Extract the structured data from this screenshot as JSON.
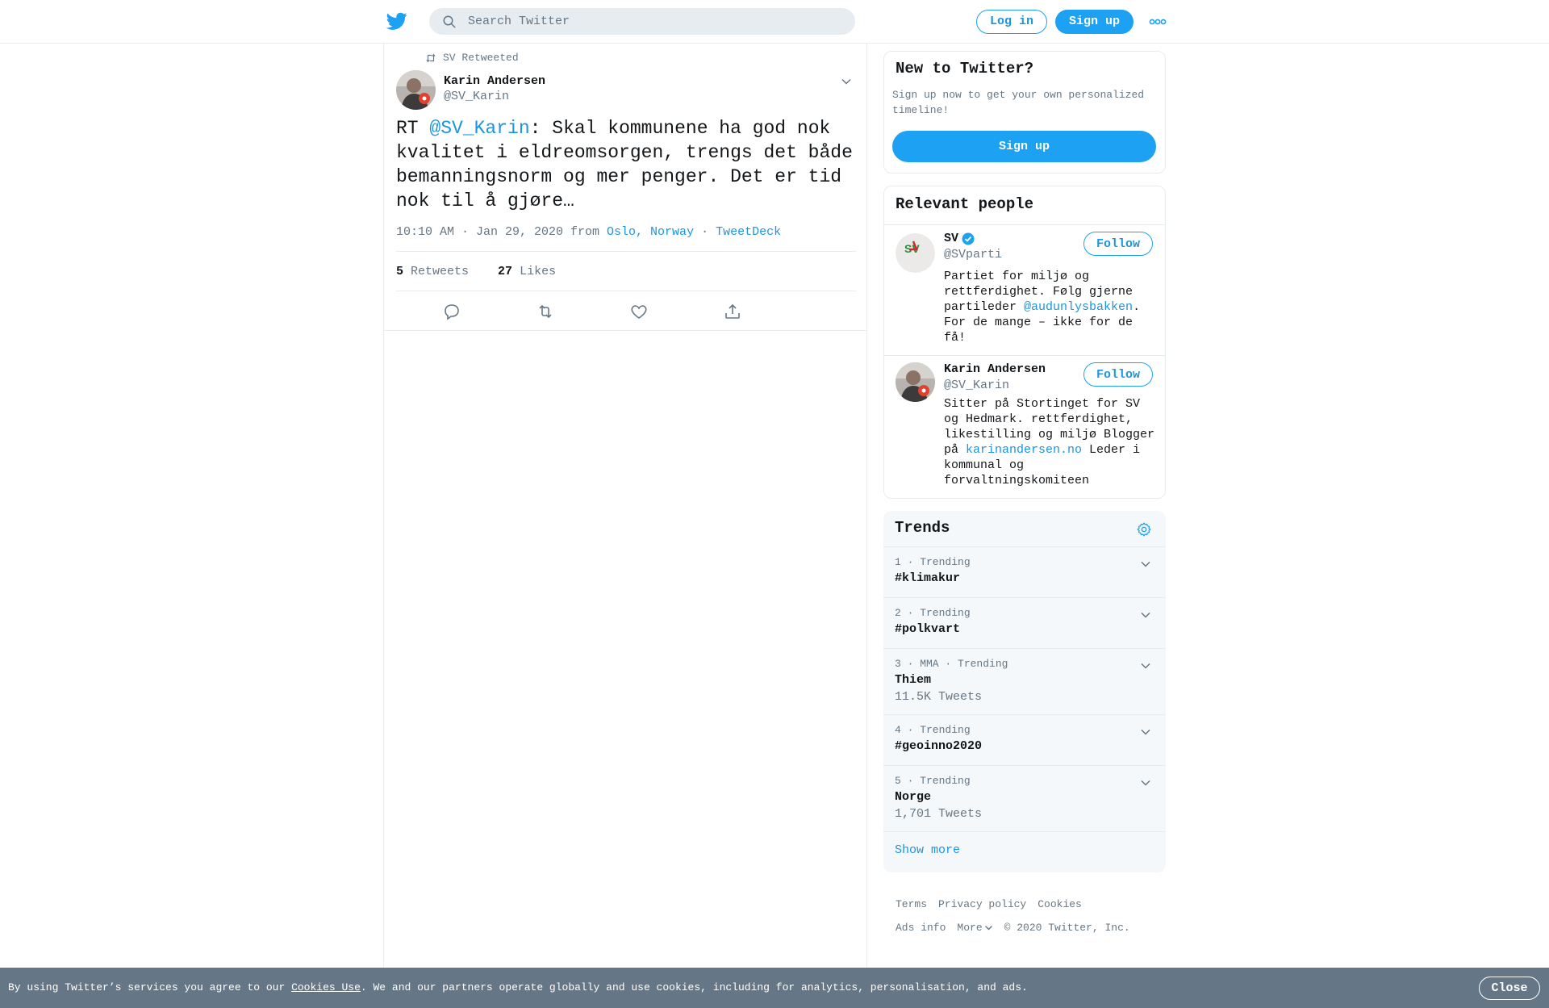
{
  "colors": {
    "brand": "#1da1f2",
    "link": "#1b95e0",
    "muted": "#657786",
    "border": "#e6ecf0",
    "cookie_bg": "#657786"
  },
  "header": {
    "search_placeholder": "Search Twitter",
    "login_label": "Log in",
    "signup_label": "Sign up"
  },
  "tweet": {
    "retweeted_by": "SV Retweeted",
    "author_name": "Karin Andersen",
    "author_handle": "@SV_Karin",
    "text_prefix": "RT ",
    "text_mention": "@SV_Karin",
    "text_body": ": Skal kommunene ha god nok kvalitet i eldreomsorgen, trengs det både bemanningsnorm og mer penger. Det er tid nok til å gjøre…",
    "timestamp": "10:10 AM · Jan 29, 2020 from ",
    "location": "Oslo, Norway",
    "separator": " · ",
    "source": "TweetDeck",
    "retweets_count": "5",
    "retweets_label": " Retweets",
    "likes_count": "27",
    "likes_label": " Likes"
  },
  "new_to_twitter": {
    "title": "New to Twitter?",
    "description": "Sign up now to get your own personalized timeline!",
    "button": "Sign up"
  },
  "relevant_people": {
    "title": "Relevant people",
    "follow_label": "Follow",
    "people": [
      {
        "name": "SV",
        "handle": "@SVparti",
        "bio_1": "Partiet for miljø og rettferdighet. Følg gjerne partileder ",
        "bio_link": "@audunlysbakken",
        "bio_2": ". For de mange – ikke for de få!",
        "avatar_text": "SV"
      },
      {
        "name": "Karin Andersen",
        "handle": "@SV_Karin",
        "bio_1": "Sitter på Stortinget for SV og Hedmark. rettferdighet, likestilling og miljø Blogger på ",
        "bio_link": "karinandersen.no",
        "bio_2": " Leder i kommunal og forvaltningskomiteen"
      }
    ]
  },
  "trends": {
    "title": "Trends",
    "items": [
      {
        "meta": "1 · Trending",
        "name": "#klimakur",
        "count": ""
      },
      {
        "meta": "2 · Trending",
        "name": "#polkvart",
        "count": ""
      },
      {
        "meta": "3 · MMA · Trending",
        "name": "Thiem",
        "count": "11.5K Tweets"
      },
      {
        "meta": "4 · Trending",
        "name": "#geoinno2020",
        "count": ""
      },
      {
        "meta": "5 · Trending",
        "name": "Norge",
        "count": "1,701 Tweets"
      }
    ],
    "show_more": "Show more"
  },
  "footer": {
    "terms": "Terms",
    "privacy": "Privacy policy",
    "cookies": "Cookies",
    "ads_info": "Ads info",
    "more": "More",
    "copyright": "© 2020 Twitter, Inc."
  },
  "cookie_bar": {
    "text_1": "By using Twitter’s services you agree to our ",
    "link": "Cookies Use",
    "text_2": ". We and our partners operate globally and use cookies, including for analytics, personalisation, and ads.",
    "close": "Close"
  }
}
